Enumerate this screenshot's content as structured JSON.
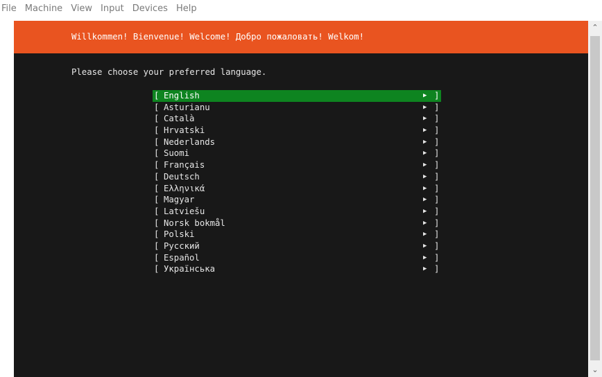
{
  "menu": [
    "File",
    "Machine",
    "View",
    "Input",
    "Devices",
    "Help"
  ],
  "header": {
    "welcome": "Willkommen! Bienvenue! Welcome! Добро пожаловать! Welkom!"
  },
  "prompt": "Please choose your preferred language.",
  "brackets": {
    "open": "[",
    "close": "]",
    "arrow": "▶"
  },
  "languages": [
    "English",
    "Asturianu",
    "Català",
    "Hrvatski",
    "Nederlands",
    "Suomi",
    "Français",
    "Deutsch",
    "Ελληνικά",
    "Magyar",
    "Latviešu",
    "Norsk bokmål",
    "Polski",
    "Русский",
    "Español",
    "Українська"
  ],
  "selected_index": 0,
  "colors": {
    "header_bg": "#e95420",
    "selected_bg": "#0e8420",
    "screen_bg": "#181818"
  },
  "icons": {
    "scroll_up": "chevron-up-icon",
    "scroll_down": "chevron-down-icon"
  }
}
